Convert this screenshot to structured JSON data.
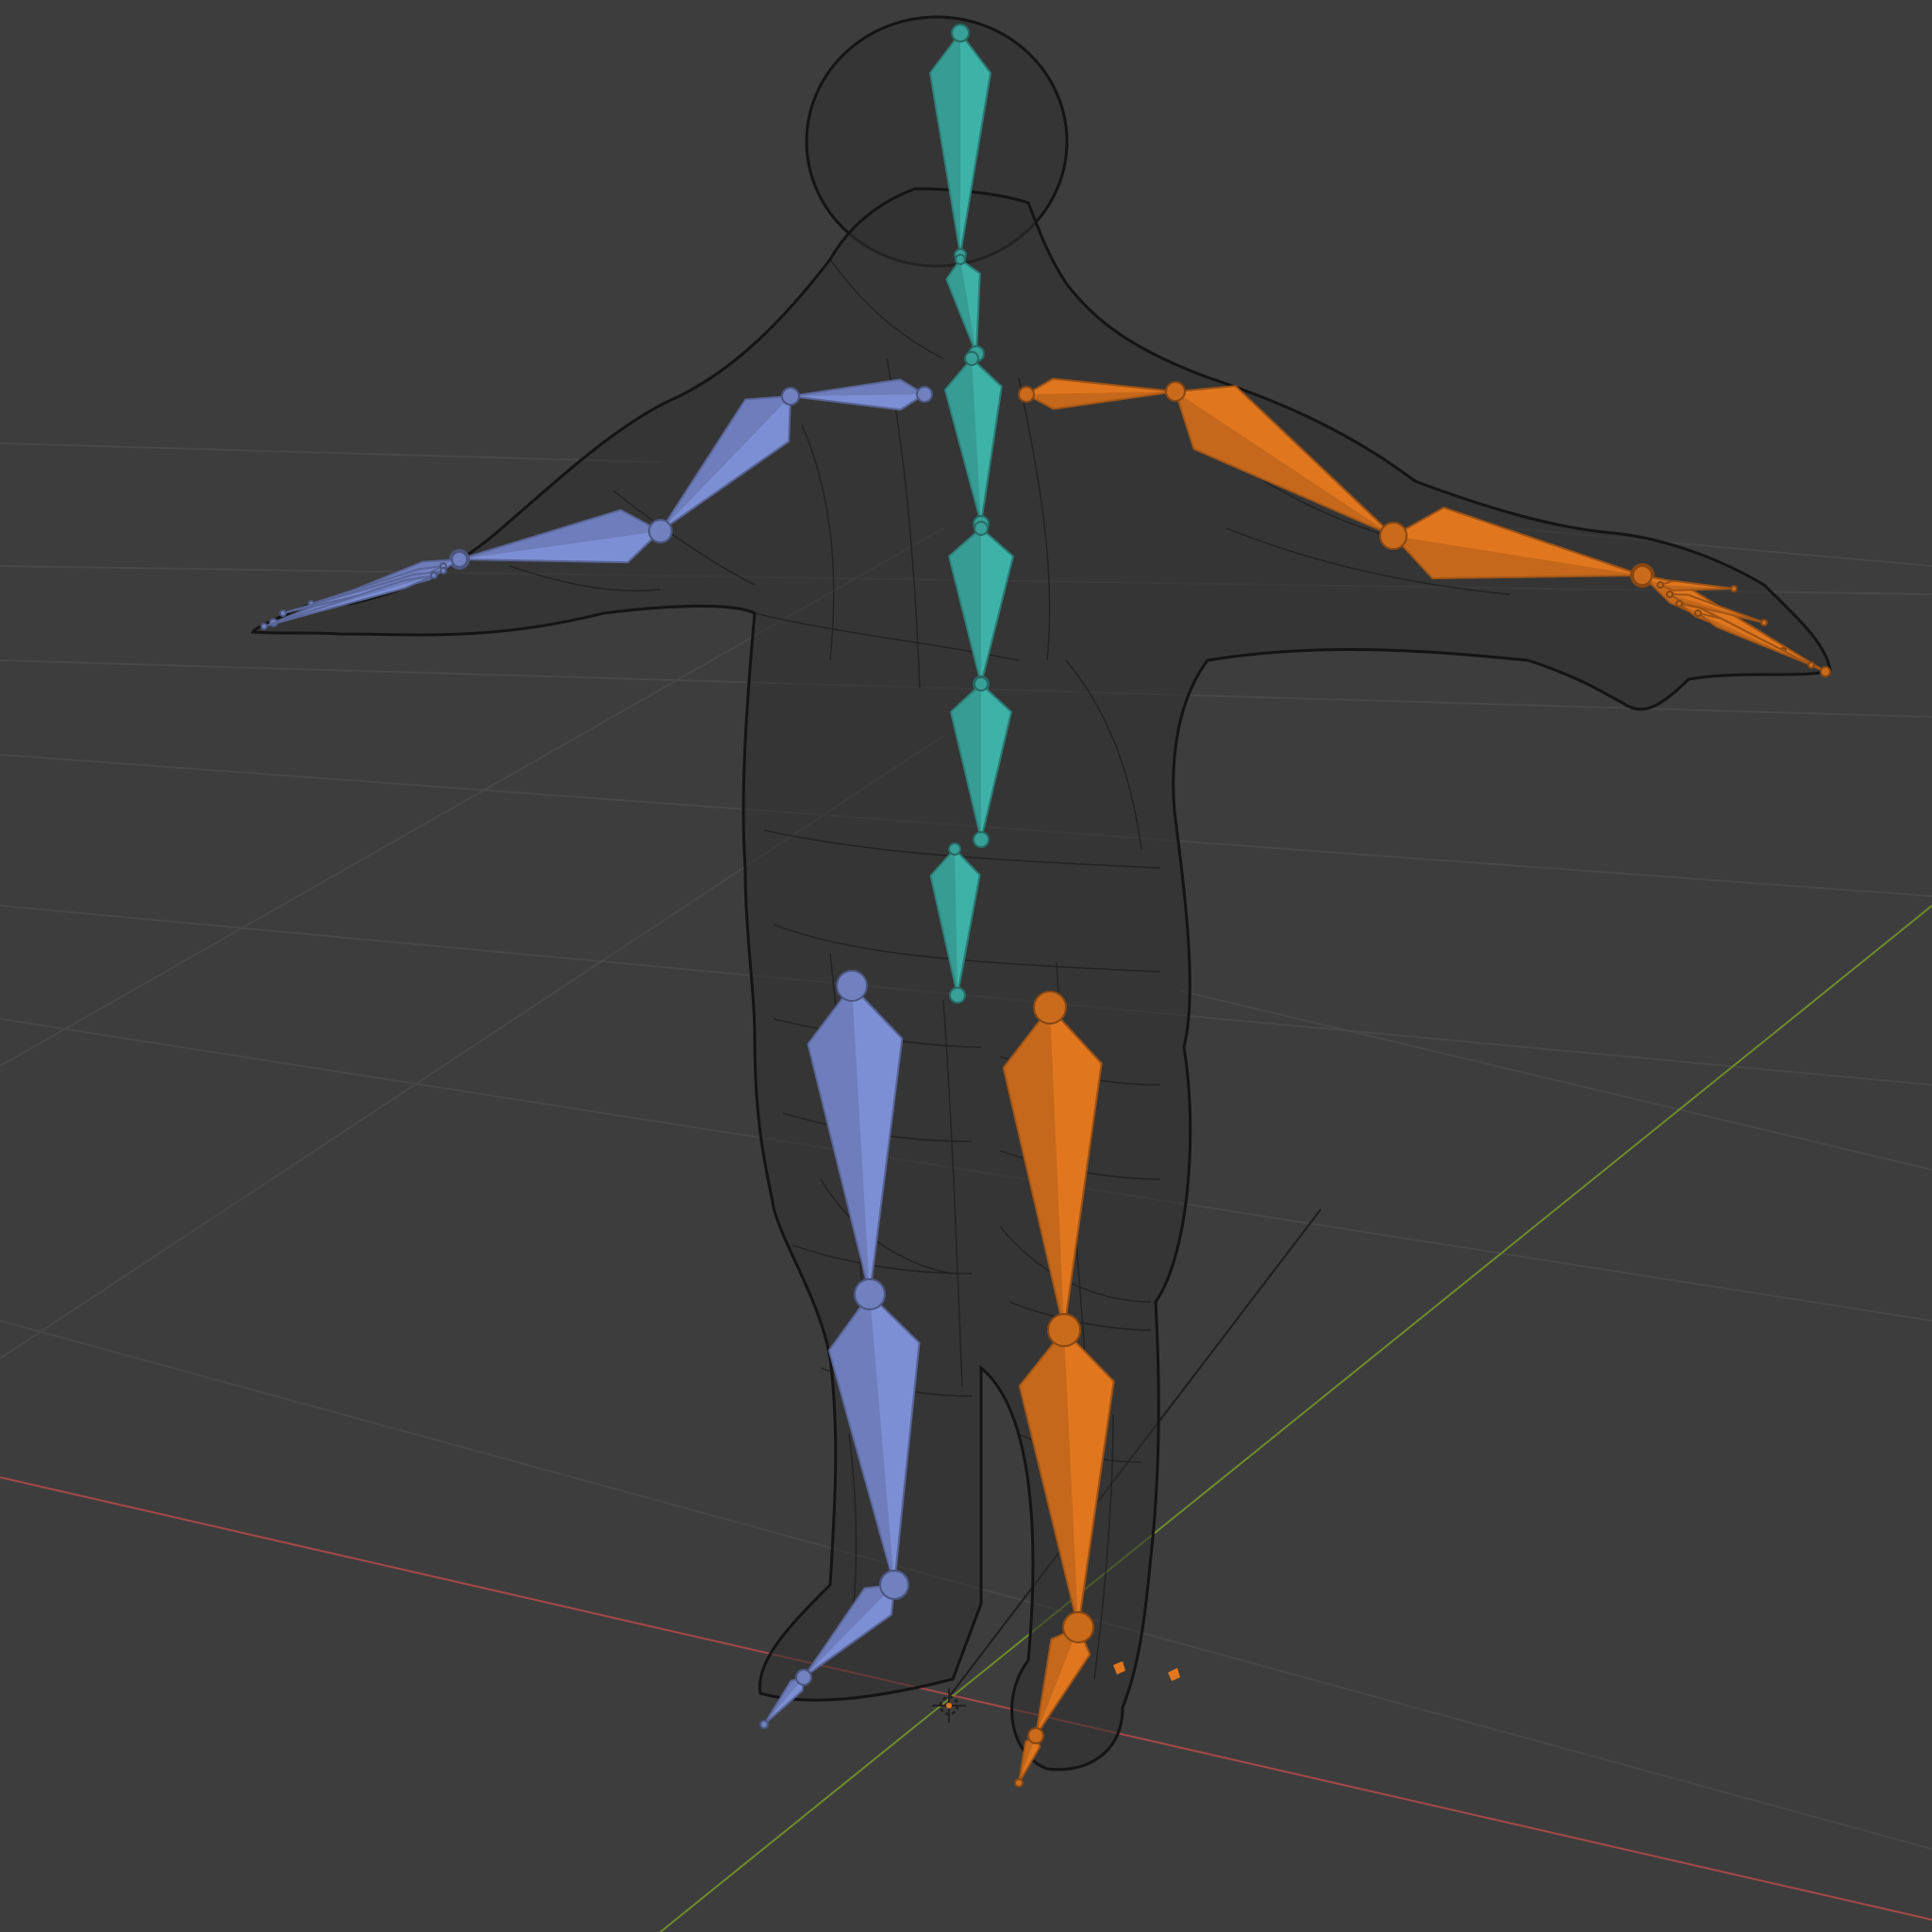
{
  "viewport": {
    "mode": "3D viewport",
    "background_color": "#3d3d3d",
    "grid_color": "#474747",
    "axis_x_color": "#a54848",
    "axis_y_color": "#6e8a2c",
    "wireframe_color": "#141414"
  },
  "armature": {
    "colors": {
      "spine": "#3fb2a8",
      "left_side": "#7d8fd4",
      "right_side": "#e0771f"
    },
    "bone_groups": [
      {
        "name": "spine",
        "icon": "bone-chain-icon"
      },
      {
        "name": "left",
        "icon": "bone-chain-icon"
      },
      {
        "name": "right",
        "icon": "bone-chain-icon"
      }
    ]
  },
  "cursor": {
    "icon": "3d-cursor-icon"
  }
}
